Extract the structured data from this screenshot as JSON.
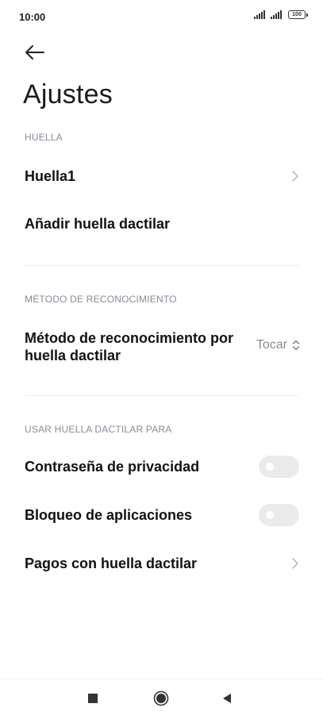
{
  "status_bar": {
    "time": "10:00",
    "battery": "100"
  },
  "header": {
    "back_icon": "arrow-left-icon",
    "title": "Ajustes"
  },
  "sections": {
    "huella": {
      "header": "HUELLA",
      "items": [
        {
          "label": "Huella1",
          "icon": "chevron-right-icon"
        },
        {
          "label": "Añadir huella dactilar"
        }
      ]
    },
    "metodo": {
      "header": "MÉTODO DE RECONOCIMIENTO",
      "label_line1": "Método de reconocimiento por",
      "label_line2": "huella dactilar",
      "value": "Tocar",
      "value_icon": "up-down-chevron-icon"
    },
    "usar": {
      "header": "USAR HUELLA DACTILAR PARA",
      "items": [
        {
          "label": "Contraseña de privacidad",
          "toggle": false
        },
        {
          "label": "Bloqueo de aplicaciones",
          "toggle": false
        },
        {
          "label": "Pagos con huella dactilar",
          "icon": "chevron-right-icon"
        }
      ]
    }
  },
  "nav_bar": {
    "recents_icon": "square-icon",
    "home_icon": "circle-icon",
    "back_icon": "triangle-back-icon"
  },
  "colors": {
    "section_header": "#8a8a9a",
    "toggle_off": "#ebebeb",
    "divider": "#ececec"
  }
}
